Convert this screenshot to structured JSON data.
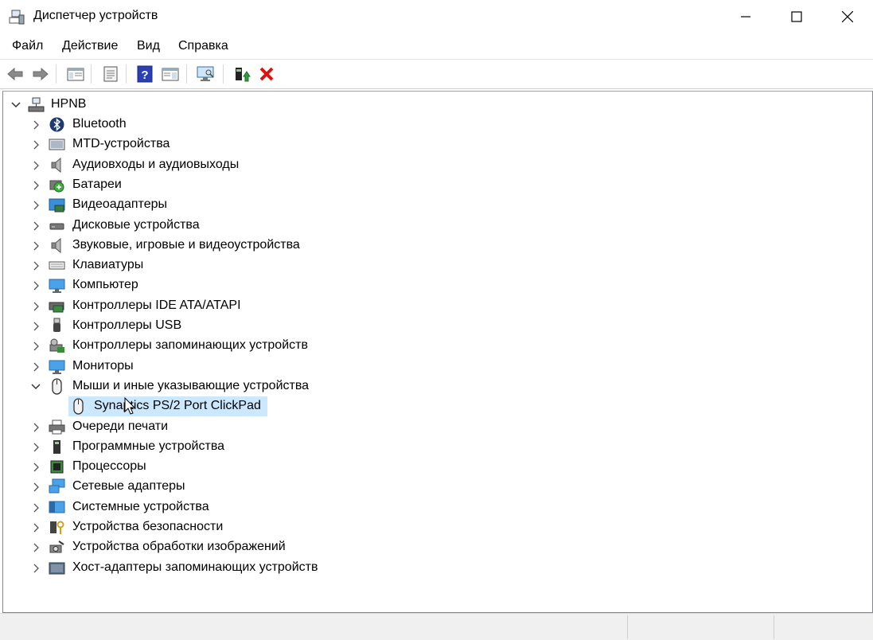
{
  "window": {
    "title": "Диспетчер устройств",
    "icon": "device-manager-icon"
  },
  "menu": [
    {
      "label": "Файл"
    },
    {
      "label": "Действие"
    },
    {
      "label": "Вид"
    },
    {
      "label": "Справка"
    }
  ],
  "toolbar": {
    "buttons": [
      "back-icon",
      "forward-icon",
      "show-hide-console-tree-icon",
      "properties-icon",
      "help-icon",
      "action-pane-icon",
      "scan-hardware-icon",
      "update-driver-icon",
      "uninstall-icon"
    ]
  },
  "tree": {
    "root": {
      "label": "HPNB",
      "icon": "computer-network-icon"
    },
    "categories": [
      {
        "label": "Bluetooth",
        "icon": "bluetooth-icon"
      },
      {
        "label": "MTD-устройства",
        "icon": "mtd-icon"
      },
      {
        "label": "Аудиовходы и аудиовыходы",
        "icon": "speaker-icon"
      },
      {
        "label": "Батареи",
        "icon": "battery-icon"
      },
      {
        "label": "Видеоадаптеры",
        "icon": "display-adapter-icon"
      },
      {
        "label": "Дисковые устройства",
        "icon": "disk-drive-icon"
      },
      {
        "label": "Звуковые, игровые и видеоустройства",
        "icon": "sound-icon"
      },
      {
        "label": "Клавиатуры",
        "icon": "keyboard-icon"
      },
      {
        "label": "Компьютер",
        "icon": "monitor-icon"
      },
      {
        "label": "Контроллеры IDE ATA/ATAPI",
        "icon": "ide-controller-icon"
      },
      {
        "label": "Контроллеры USB",
        "icon": "usb-icon"
      },
      {
        "label": "Контроллеры запоминающих устройств",
        "icon": "storage-controller-icon"
      },
      {
        "label": "Мониторы",
        "icon": "monitor-icon"
      },
      {
        "label": "Мыши и иные указывающие устройства",
        "icon": "mouse-icon",
        "expanded": true
      },
      {
        "label": "Synaptics PS/2 Port ClickPad",
        "icon": "mouse-icon",
        "child": true,
        "selected": true
      },
      {
        "label": "Очереди печати",
        "icon": "printer-icon"
      },
      {
        "label": "Программные устройства",
        "icon": "software-device-icon"
      },
      {
        "label": "Процессоры",
        "icon": "processor-icon"
      },
      {
        "label": "Сетевые адаптеры",
        "icon": "network-adapter-icon"
      },
      {
        "label": "Системные устройства",
        "icon": "system-device-icon"
      },
      {
        "label": "Устройства безопасности",
        "icon": "security-device-icon"
      },
      {
        "label": "Устройства обработки изображений",
        "icon": "imaging-device-icon"
      },
      {
        "label": "Хост-адаптеры запоминающих устройств",
        "icon": "storage-host-icon"
      }
    ]
  }
}
